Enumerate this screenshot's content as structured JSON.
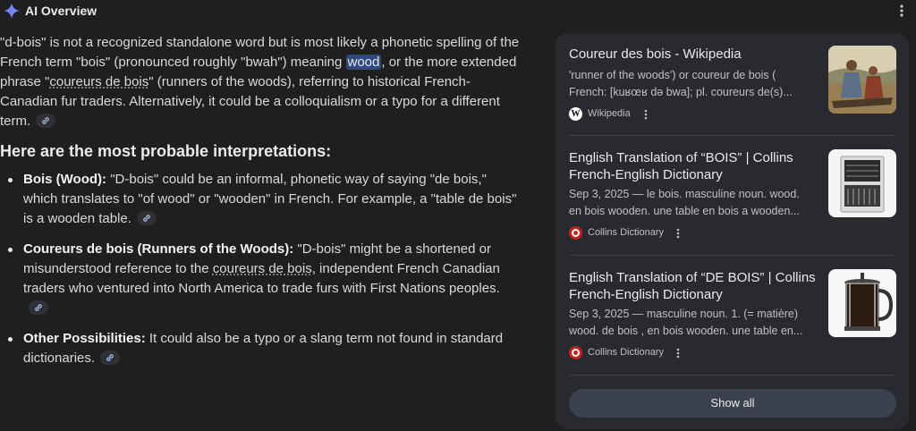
{
  "header": {
    "title": "AI Overview",
    "icon": "sparkle-icon",
    "menu_icon": "more-vert-icon"
  },
  "intro": {
    "part1": "\"d-bois\" is not a recognized standalone word but is most likely a phonetic spelling of the French term \"bois\" (pronounced roughly \"bwah\") meaning ",
    "highlight": "wood",
    "part2": ", or the more extended phrase \"",
    "underlined": "coureurs de bois",
    "part3": "\" (runners of the woods), referring to historical French-Canadian fur traders. Alternatively, it could be a colloquialism or a typo for a different term."
  },
  "subheading": "Here are the most probable interpretations:",
  "items": [
    {
      "bold": "Bois (Wood):",
      "text": " \"D-bois\" could be an informal, phonetic way of saying \"de bois,\" which translates to \"of wood\" or \"wooden\" in French. For example, a \"table de bois\" is a wooden table."
    },
    {
      "bold": "Coureurs de bois (Runners of the Woods):",
      "text_a": " \"D-bois\" might be a shortened or misunderstood reference to the ",
      "underlined": "coureurs de bois",
      "text_b": ", independent French Canadian traders who ventured into North America to trade furs with First Nations peoples."
    },
    {
      "bold": "Other Possibilities:",
      "text": " It could also be a typo or a slang term not found in standard dictionaries."
    }
  ],
  "sources": [
    {
      "title": "Coureur des bois - Wikipedia",
      "snippet_line1": "'runner of the woods') or coureur de bois (",
      "snippet_line2": "French: [kuʁœʁ də bwa]; pl. coureurs de(s)...",
      "site": "Wikipedia",
      "favicon": "W"
    },
    {
      "title": "English Translation of “BOIS” | Collins French-English Dictionary",
      "snippet_line1": "Sep 3, 2025 — le bois. masculine noun. wood.",
      "snippet_line2": "en bois wooden. une table en bois a wooden...",
      "site": "Collins Dictionary"
    },
    {
      "title": "English Translation of “DE BOIS” | Collins French-English Dictionary",
      "snippet_line1": "Sep 3, 2025 — masculine noun. 1. (= matière)",
      "snippet_line2": "wood. de bois , en bois wooden. une table en...",
      "site": "Collins Dictionary"
    }
  ],
  "show_all": "Show all",
  "colors": {
    "background": "#1f1f1f",
    "panel": "#282a2f",
    "highlight": "#2f4a80",
    "button": "#3c4150"
  }
}
